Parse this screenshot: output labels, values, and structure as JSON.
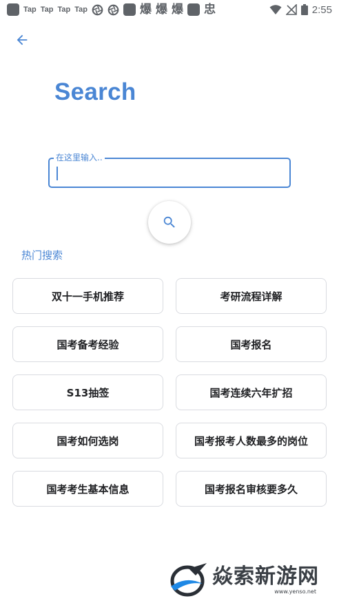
{
  "status_bar": {
    "tap_labels": [
      "Tap",
      "Tap",
      "Tap",
      "Tap"
    ],
    "app_glyphs": [
      "爆",
      "爆",
      "爆"
    ],
    "last_glyph": "忠",
    "time": "2:55"
  },
  "page": {
    "title": "Search"
  },
  "search": {
    "label": "在这里输入..",
    "value": ""
  },
  "hot_search": {
    "label": "热门搜索",
    "items": [
      "双十一手机推荐",
      "考研流程详解",
      "国考备考经验",
      "国考报名",
      "S13抽签",
      "国考连续六年扩招",
      "国考如何选岗",
      "国考报考人数最多的岗位",
      "国考考生基本信息",
      "国考报名审核要多久"
    ]
  },
  "watermark": {
    "name": "焱索新游网",
    "url": "www.yenso.net"
  },
  "colors": {
    "accent": "#4a86d4",
    "chip_border": "#d9dbe0",
    "text": "#202124"
  }
}
